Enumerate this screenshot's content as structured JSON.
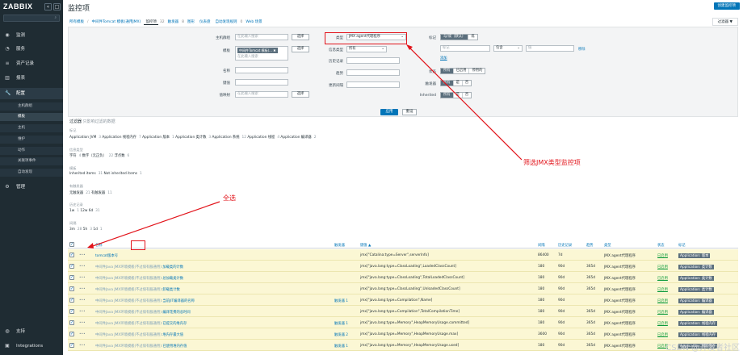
{
  "sidebar": {
    "logo": "ZABBIX",
    "collapse_icon": "collapse-icon",
    "expand_icon": "expand-icon",
    "search_placeholder": "",
    "nav": [
      {
        "label": "监测",
        "icon": "eye-icon"
      },
      {
        "label": "服务",
        "icon": "clock-icon"
      },
      {
        "label": "资产记录",
        "icon": "list-icon"
      },
      {
        "label": "报表",
        "icon": "chart-icon"
      },
      {
        "label": "配置",
        "icon": "wrench-icon"
      }
    ],
    "sub": [
      "主机群组",
      "模板",
      "主机",
      "维护",
      "动作",
      "关联项事件",
      "自动发现"
    ],
    "admin": "管理",
    "support": "支持",
    "integrations": "Integrations"
  },
  "header": {
    "title": "监控项",
    "create": "创建监控项",
    "filter_tab": "过滤器"
  },
  "crumbs": {
    "all": "所有模板",
    "template": "中间件Tomcat 模板(通用JMX)",
    "items": "监控项",
    "items_count": "32",
    "triggers": "触发器",
    "triggers_count": "8",
    "graphs": "图形",
    "dashboards": "仪表盘",
    "discovery": "自动发现规则",
    "discovery_count": "0",
    "web": "Web 场景"
  },
  "filter": {
    "hostgroup_label": "主机群组",
    "hostgroup_placeholder": "在此输入搜索",
    "select": "选择",
    "template_label": "模板",
    "template_tag": "中间件Tomcat 模板(...",
    "template_placeholder": "在此输入搜索",
    "name_label": "名称",
    "key_label": "键值",
    "interval_label": "更新间隔",
    "history_label": "历史记录",
    "trends_label": "趋势",
    "valuemap_label": "值映射",
    "valuemap_placeholder": "在此输入搜索",
    "type_label": "类型",
    "type_value": "JMX agent代理程序",
    "infotype_label": "信息类型",
    "infotype_value": "所有",
    "tags_label": "标记",
    "and_or": "与/或（默认）",
    "or": "或",
    "tag_placeholder": "标记",
    "contains": "包含",
    "value_placeholder": "值",
    "remove": "移除",
    "add": "添加",
    "state_label": "状态",
    "state_opts": [
      "所有",
      "已启用",
      "停用的"
    ],
    "triggers_label": "触发器",
    "yn": [
      "所有",
      "是",
      "否"
    ],
    "inherited_label": "Inherited",
    "apply": "应用",
    "reset": "重设"
  },
  "subfilter": {
    "title": "过滤器",
    "hint": "只影响过滤的数据",
    "tag_group": "标记",
    "tags": [
      "Application JVM",
      "3",
      "Application 线程内存",
      "7",
      "Application 版本",
      "1",
      "Application 类计数",
      "3",
      "Application 系统",
      "12",
      "Application 线程",
      "4",
      "Application 编译器",
      "2"
    ],
    "infotype_group": "信息类型",
    "infotype": [
      "字符",
      "4",
      "数字（无正负）",
      "22",
      "浮点数",
      "6"
    ],
    "template_group": "模板",
    "template": [
      "Inherited items",
      "31",
      "Not inherited items",
      "1"
    ],
    "trigger_group": "有触发器",
    "trigger": [
      "无触发器",
      "21",
      "有触发器",
      "11"
    ],
    "history_group": "历史记录",
    "history": [
      "1w",
      "1",
      "12w 6d",
      "31"
    ],
    "interval_group": "间隔",
    "interval": [
      "3m",
      "28",
      "5h",
      "3",
      "1d",
      "1"
    ]
  },
  "table": {
    "headers": [
      "名称",
      "触发器",
      "键值 ▲",
      "间隔",
      "历史记录",
      "趋势",
      "类型",
      "状态",
      "标记"
    ],
    "rows": [
      {
        "name": "tomcat版本号",
        "prefix": "",
        "trig": "",
        "key": "jmx[\"Catalina:type=Server\",serverInfo]",
        "int": "86400",
        "hist": "7d",
        "trend": "",
        "type": "JMX agent代理程序",
        "status": "已启用",
        "tag": "Application: 版本"
      },
      {
        "name": "加载类的计数",
        "prefix": "中间件Java JMX环境模板(不过保有服通用):",
        "trig": "",
        "key": "jmx[\"java.lang:type=ClassLoading\",LoadedClassCount]",
        "int": "180",
        "hist": "90d",
        "trend": "365d",
        "type": "JMX agent代理程序",
        "status": "已启用",
        "tag": "Application: 类计数"
      },
      {
        "name": "总加载类计数",
        "prefix": "中间件Java JMX环境模板(不过保有服通用):",
        "trig": "",
        "key": "jmx[\"java.lang:type=ClassLoading\",TotalLoadedClassCount]",
        "int": "180",
        "hist": "90d",
        "trend": "365d",
        "type": "JMX agent代理程序",
        "status": "已启用",
        "tag": "Application: 类计数"
      },
      {
        "name": "卸载类计数",
        "prefix": "中间件Java JMX环境模板(不过保有服通用):",
        "trig": "",
        "key": "jmx[\"java.lang:type=ClassLoading\",UnloadedClassCount]",
        "int": "180",
        "hist": "90d",
        "trend": "365d",
        "type": "JMX agent代理程序",
        "status": "已启用",
        "tag": "Application: 类计数"
      },
      {
        "name": "当前JIT编译器的名称",
        "prefix": "中间件Java JMX环境模板(不过保有服通用):",
        "trig": "触发器 1",
        "key": "jmx[\"java.lang:type=Compilation\",Name]",
        "int": "180",
        "hist": "90d",
        "trend": "",
        "type": "JMX agent代理程序",
        "status": "已启用",
        "tag": "Application: 编译器"
      },
      {
        "name": "编译花费的总时间",
        "prefix": "中间件Java JMX环境模板(不过保有服通用):",
        "trig": "",
        "key": "jmx[\"java.lang:type=Compilation\",TotalCompilationTime]",
        "int": "180",
        "hist": "90d",
        "trend": "365d",
        "type": "JMX agent代理程序",
        "status": "已启用",
        "tag": "Application: 编译器"
      },
      {
        "name": "已提交的堆内存",
        "prefix": "中间件Java JMX环境模板(不过保有服通用):",
        "trig": "触发器 1",
        "key": "jmx[\"java.lang:type=Memory\",HeapMemoryUsage.committed]",
        "int": "180",
        "hist": "90d",
        "trend": "365d",
        "type": "JMX agent代理程序",
        "status": "已启用",
        "tag": "Application: 线程内存"
      },
      {
        "name": "堆内存最大值",
        "prefix": "中间件Java JMX环境模板(不过保有服通用):",
        "trig": "触发器 2",
        "key": "jmx[\"java.lang:type=Memory\",HeapMemoryUsage.max]",
        "int": "3600",
        "hist": "90d",
        "trend": "365d",
        "type": "JMX agent代理程序",
        "status": "已启用",
        "tag": "Application: 线程内存"
      },
      {
        "name": "已使用堆内存值",
        "prefix": "中间件Java JMX环境模板(不过保有服通用):",
        "trig": "触发器 1",
        "key": "jmx[\"java.lang:type=Memory\",HeapMemoryUsage.used]",
        "int": "180",
        "hist": "90d",
        "trend": "365d",
        "type": "JMX agent代理程序",
        "status": "已启用",
        "tag": "Application: 线程内存"
      }
    ]
  },
  "annotations": {
    "filter_note": "筛选JMX类型监控项",
    "select_all": "全选"
  },
  "watermark": "CSDN @开发者社区"
}
